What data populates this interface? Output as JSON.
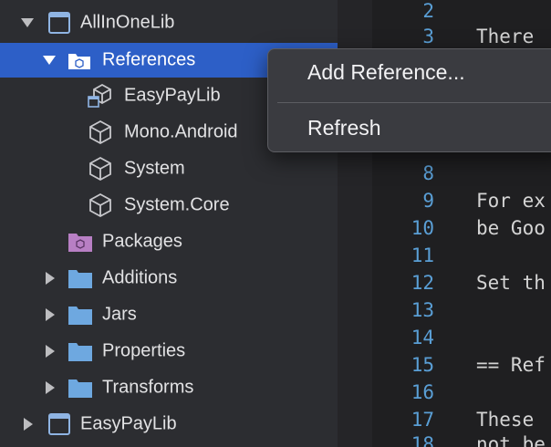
{
  "tree": {
    "items": [
      {
        "label": "AllInOneLib",
        "icon": "project-icon",
        "expanded": true
      },
      {
        "label": "References",
        "icon": "references-folder-icon",
        "expanded": true,
        "selected": true
      },
      {
        "label": "EasyPayLib",
        "icon": "project-reference-icon"
      },
      {
        "label": "Mono.Android",
        "icon": "assembly-icon"
      },
      {
        "label": "System",
        "icon": "assembly-icon"
      },
      {
        "label": "System.Core",
        "icon": "assembly-icon"
      },
      {
        "label": "Packages",
        "icon": "packages-folder-icon"
      },
      {
        "label": "Additions",
        "icon": "folder-icon",
        "expanded": false
      },
      {
        "label": "Jars",
        "icon": "folder-icon",
        "expanded": false
      },
      {
        "label": "Properties",
        "icon": "folder-icon",
        "expanded": false
      },
      {
        "label": "Transforms",
        "icon": "folder-icon",
        "expanded": false
      },
      {
        "label": "EasyPayLib",
        "icon": "project-icon",
        "expanded": false
      }
    ]
  },
  "context_menu": {
    "items": [
      {
        "label": "Add Reference..."
      },
      {
        "label": "Refresh"
      }
    ]
  },
  "editor": {
    "lines": [
      {
        "num": "2",
        "text": ""
      },
      {
        "num": "3",
        "text": "There"
      },
      {
        "num": "8",
        "text": ""
      },
      {
        "num": "9",
        "text": "For ex"
      },
      {
        "num": "10",
        "text": "be Goo"
      },
      {
        "num": "11",
        "text": ""
      },
      {
        "num": "12",
        "text": "Set th"
      },
      {
        "num": "13",
        "text": ""
      },
      {
        "num": "14",
        "text": ""
      },
      {
        "num": "15",
        "text": "== Ref"
      },
      {
        "num": "16",
        "text": ""
      },
      {
        "num": "17",
        "text": "These"
      },
      {
        "num": "18",
        "text": "not be"
      }
    ]
  },
  "colors": {
    "selection": "#2d5fc7",
    "line_number": "#5a9fd6",
    "folder": "#6ea8e0",
    "packages_folder": "#b87fc4"
  }
}
